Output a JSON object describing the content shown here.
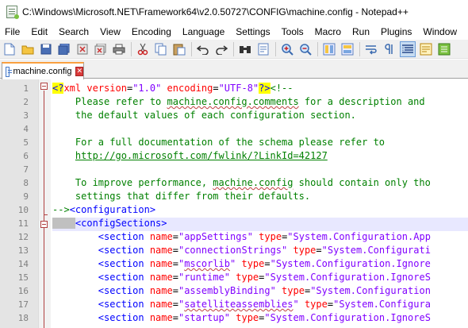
{
  "window": {
    "title": "C:\\Windows\\Microsoft.NET\\Framework64\\v2.0.50727\\CONFIG\\machine.config - Notepad++"
  },
  "menu": [
    "File",
    "Edit",
    "Search",
    "View",
    "Encoding",
    "Language",
    "Settings",
    "Tools",
    "Macro",
    "Run",
    "Plugins",
    "Window",
    "?"
  ],
  "toolbar": {
    "icons": [
      "new-file-icon",
      "open-file-icon",
      "save-icon",
      "save-all-icon",
      "close-icon",
      "close-all-icon",
      "print-icon",
      "cut-icon",
      "copy-icon",
      "paste-icon",
      "undo-icon",
      "redo-icon",
      "find-icon",
      "replace-icon",
      "zoom-in-icon",
      "zoom-out-icon",
      "sync-vertical-icon",
      "sync-horizontal-icon",
      "word-wrap-icon",
      "show-all-chars-icon",
      "indent-guide-icon",
      "doc-map-icon",
      "function-list-icon"
    ]
  },
  "tab": {
    "label": "machine.config",
    "close": "✕"
  },
  "editor": {
    "line_numbers": [
      "1",
      "2",
      "3",
      "4",
      "5",
      "6",
      "7",
      "8",
      "9",
      "10",
      "11",
      "12",
      "13",
      "14",
      "15",
      "16",
      "17",
      "18"
    ],
    "lines": {
      "l1": {
        "pi_open": "<?",
        "decl": "xml",
        "attr1": "version",
        "val1": "\"1.0\"",
        "attr2": "encoding",
        "val2": "\"UTF-8\"",
        "pi_close": "?>",
        "comment_open": "<!--"
      },
      "l2": {
        "a": "    Please refer to ",
        "b": "machine.config.comments",
        "c": " for a description and"
      },
      "l3": {
        "text": "    the default values of each configuration section."
      },
      "l4": {
        "text": ""
      },
      "l5": {
        "text": "    For a full documentation of the schema please refer to"
      },
      "l6": {
        "indent": "    ",
        "link": "http://go.microsoft.com/fwlink/?LinkId=42127"
      },
      "l7": {
        "text": ""
      },
      "l8": {
        "a": "    To improve performance, ",
        "b": "machine.config",
        "c": " should contain only tho"
      },
      "l9": {
        "text": "    settings that differ from their defaults."
      },
      "l10": {
        "comment_close": "-->",
        "tag": "<configuration>"
      },
      "l11": {
        "tag": "<configSections>"
      },
      "l12": {
        "attr1": "appSettings",
        "attr2": "System.Configuration.App"
      },
      "l13": {
        "attr1": "connectionStrings",
        "attr2": "System.Configurati"
      },
      "l14": {
        "attr1": "mscorlib",
        "attr2": "System.Configuration.Ignore"
      },
      "l15": {
        "attr1": "runtime",
        "attr2": "System.Configuration.IgnoreS"
      },
      "l16": {
        "attr1": "assemblyBinding",
        "attr2": "System.Configuration"
      },
      "l17": {
        "attr1": "satelliteassemblies",
        "attr2": "System.Configura"
      },
      "l18": {
        "attr1": "startup",
        "attr2": "System.Configuration.IgnoreS"
      }
    },
    "section_tag": "<section",
    "name_attr": "name",
    "type_attr": "type",
    "equals": "=",
    "quote": "\""
  },
  "colors": {
    "comment": "#008000",
    "tag": "#0000ff",
    "attribute": "#ff0000",
    "value": "#8000ff",
    "tab_accent": "#f9a040",
    "current_line": "#e8e8ff"
  }
}
